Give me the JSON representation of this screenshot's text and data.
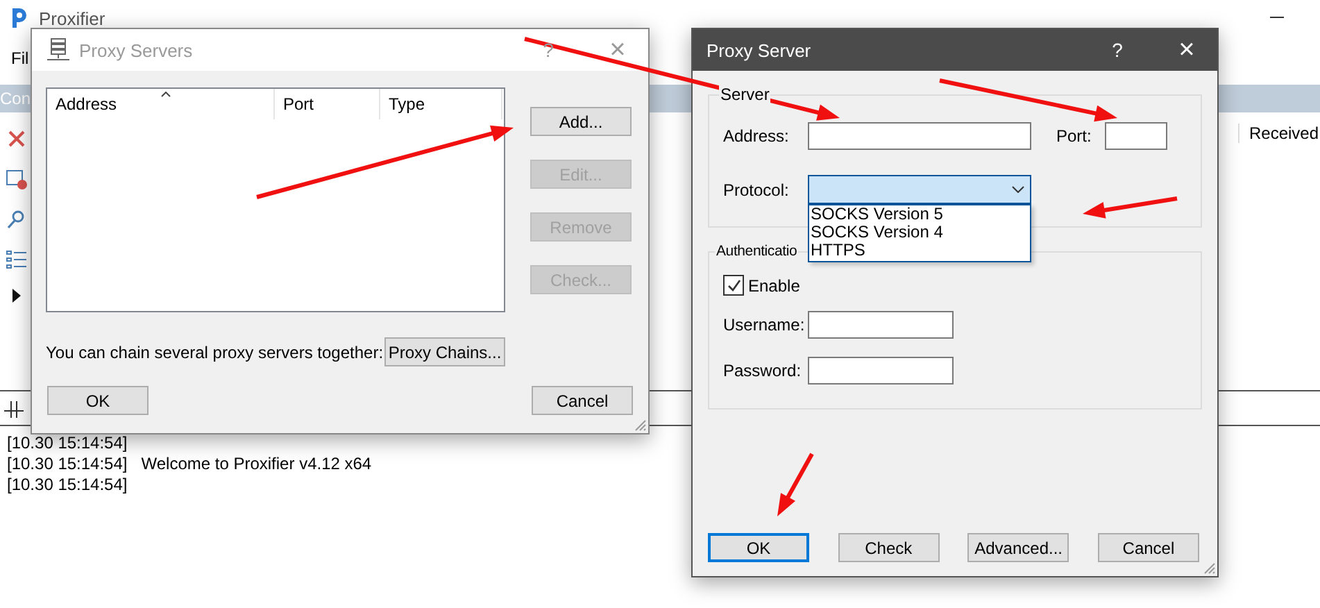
{
  "main_window": {
    "title": "Proxifier",
    "menu": [
      "Fil"
    ],
    "tab": "Con",
    "column_header": "Received",
    "log": [
      {
        "time": "[10.30 15:14:54]"
      },
      {
        "time": "[10.30 15:14:54]",
        "message": "Welcome to Proxifier v4.12 x64"
      },
      {
        "time": "[10.30 15:14:54]"
      }
    ]
  },
  "proxy_servers_dialog": {
    "title": "Proxy Servers",
    "active": false,
    "help": "?",
    "close": "×",
    "columns": [
      {
        "label": "Address",
        "sorted": true
      },
      {
        "label": "Port",
        "sorted": false
      },
      {
        "label": "Type",
        "sorted": false
      }
    ],
    "side_buttons": [
      {
        "label": "Add...",
        "disabled": false
      },
      {
        "label": "Edit...",
        "disabled": true
      },
      {
        "label": "Remove",
        "disabled": true
      },
      {
        "label": "Check...",
        "disabled": true
      }
    ],
    "chain_label": "You can chain several proxy servers together:",
    "chain_button": "Proxy Chains...",
    "ok": "OK",
    "cancel": "Cancel"
  },
  "proxy_server_dialog": {
    "title": "Proxy Server",
    "active": true,
    "help": "?",
    "close": "×",
    "server_group": "Server",
    "address_label": "Address:",
    "port_label": "Port:",
    "protocol_label": "Protocol:",
    "protocol_expanded": true,
    "protocol_options": [
      "SOCKS Version 5",
      "SOCKS Version 4",
      "HTTPS"
    ],
    "auth_group": "Authenticatio",
    "enable": {
      "label": "Enable",
      "checked": true
    },
    "username_label": "Username:",
    "password_label": "Password:",
    "buttons": [
      {
        "label": "OK",
        "focused": true
      },
      {
        "label": "Check",
        "focused": false
      },
      {
        "label": "Advanced...",
        "focused": false
      },
      {
        "label": "Cancel",
        "focused": false
      }
    ]
  }
}
